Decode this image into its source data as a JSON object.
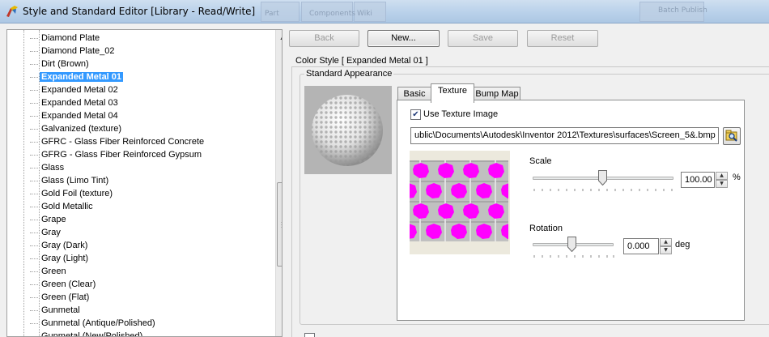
{
  "window": {
    "title": "Style and Standard Editor [Library - Read/Write]",
    "background_ghost_labels": [
      "Part",
      "Components",
      "Wiki",
      "Batch Publish"
    ]
  },
  "tree": {
    "items": [
      {
        "label": "Diamond Plate",
        "selected": false
      },
      {
        "label": "Diamond Plate_02",
        "selected": false
      },
      {
        "label": "Dirt (Brown)",
        "selected": false
      },
      {
        "label": "Expanded Metal 01",
        "selected": true
      },
      {
        "label": "Expanded Metal 02",
        "selected": false
      },
      {
        "label": "Expanded Metal 03",
        "selected": false
      },
      {
        "label": "Expanded Metal 04",
        "selected": false
      },
      {
        "label": "Galvanized (texture)",
        "selected": false
      },
      {
        "label": "GFRC -  Glass Fiber Reinforced Concrete",
        "selected": false
      },
      {
        "label": "GFRG -  Glass Fiber Reinforced Gypsum",
        "selected": false
      },
      {
        "label": "Glass",
        "selected": false
      },
      {
        "label": "Glass (Limo Tint)",
        "selected": false
      },
      {
        "label": "Gold Foil (texture)",
        "selected": false
      },
      {
        "label": "Gold Metallic",
        "selected": false
      },
      {
        "label": "Grape",
        "selected": false
      },
      {
        "label": "Gray",
        "selected": false
      },
      {
        "label": "Gray (Dark)",
        "selected": false
      },
      {
        "label": "Gray (Light)",
        "selected": false
      },
      {
        "label": "Green",
        "selected": false
      },
      {
        "label": "Green (Clear)",
        "selected": false
      },
      {
        "label": "Green (Flat)",
        "selected": false
      },
      {
        "label": "Gunmetal",
        "selected": false
      },
      {
        "label": "Gunmetal (Antique/Polished)",
        "selected": false
      },
      {
        "label": "Gunmetal (New/Polished)",
        "selected": false
      }
    ]
  },
  "toolbar": {
    "back_label": "Back",
    "new_label": "New...",
    "save_label": "Save",
    "reset_label": "Reset"
  },
  "editor": {
    "group_title": "Color Style [ Expanded Metal 01 ]",
    "appearance_title": "Standard Appearance",
    "tabs": [
      {
        "label": "Basic",
        "active": false
      },
      {
        "label": "Texture",
        "active": true
      },
      {
        "label": "Bump Map",
        "active": false
      }
    ],
    "use_texture_label": "Use Texture Image",
    "use_texture_checked": true,
    "texture_path": "ublic\\Documents\\Autodesk\\Inventor 2012\\Textures\\surfaces\\Screen_5&.bmp",
    "scale_label": "Scale",
    "scale_value": "100.00",
    "scale_unit": "%",
    "rotation_label": "Rotation",
    "rotation_value": "0.000",
    "rotation_unit": "deg"
  },
  "colors": {
    "selection": "#3399ff",
    "texture_dot": "#ff00ff",
    "texture_grid": "#c0c0c0"
  }
}
